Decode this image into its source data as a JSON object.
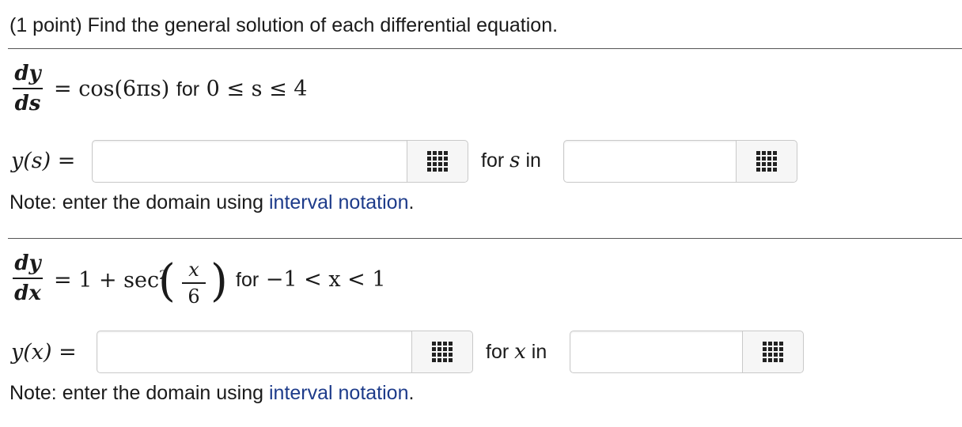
{
  "header": "(1 point) Find the general solution of each differential equation.",
  "problems": [
    {
      "frac_num": "dy",
      "frac_den": "ds",
      "rhs": "= cos(6πs)",
      "for_word": "for",
      "domain": "0 ≤ s ≤ 4",
      "answer_label": "y(s) =",
      "for_var_prefix": "for",
      "for_var": "s",
      "for_var_suffix": "in",
      "answer_value": "",
      "domain_value": "",
      "note_prefix": "Note: enter the domain using ",
      "note_link": "interval notation",
      "note_suffix": "."
    },
    {
      "frac_num": "dy",
      "frac_den": "dx",
      "rhs_prefix": "= 1 + sec",
      "rhs_exp": "2",
      "inner_num": "x",
      "inner_den": "6",
      "for_word": "for",
      "domain": "−1 < x < 1",
      "answer_label": "y(x) =",
      "for_var_prefix": "for",
      "for_var": "x",
      "for_var_suffix": "in",
      "answer_value": "",
      "domain_value": "",
      "note_prefix": "Note: enter the domain using ",
      "note_link": "interval notation",
      "note_suffix": "."
    }
  ],
  "icons": {
    "palette": "grid-icon"
  },
  "colors": {
    "link": "#1d3b8a",
    "rule": "#555555"
  }
}
